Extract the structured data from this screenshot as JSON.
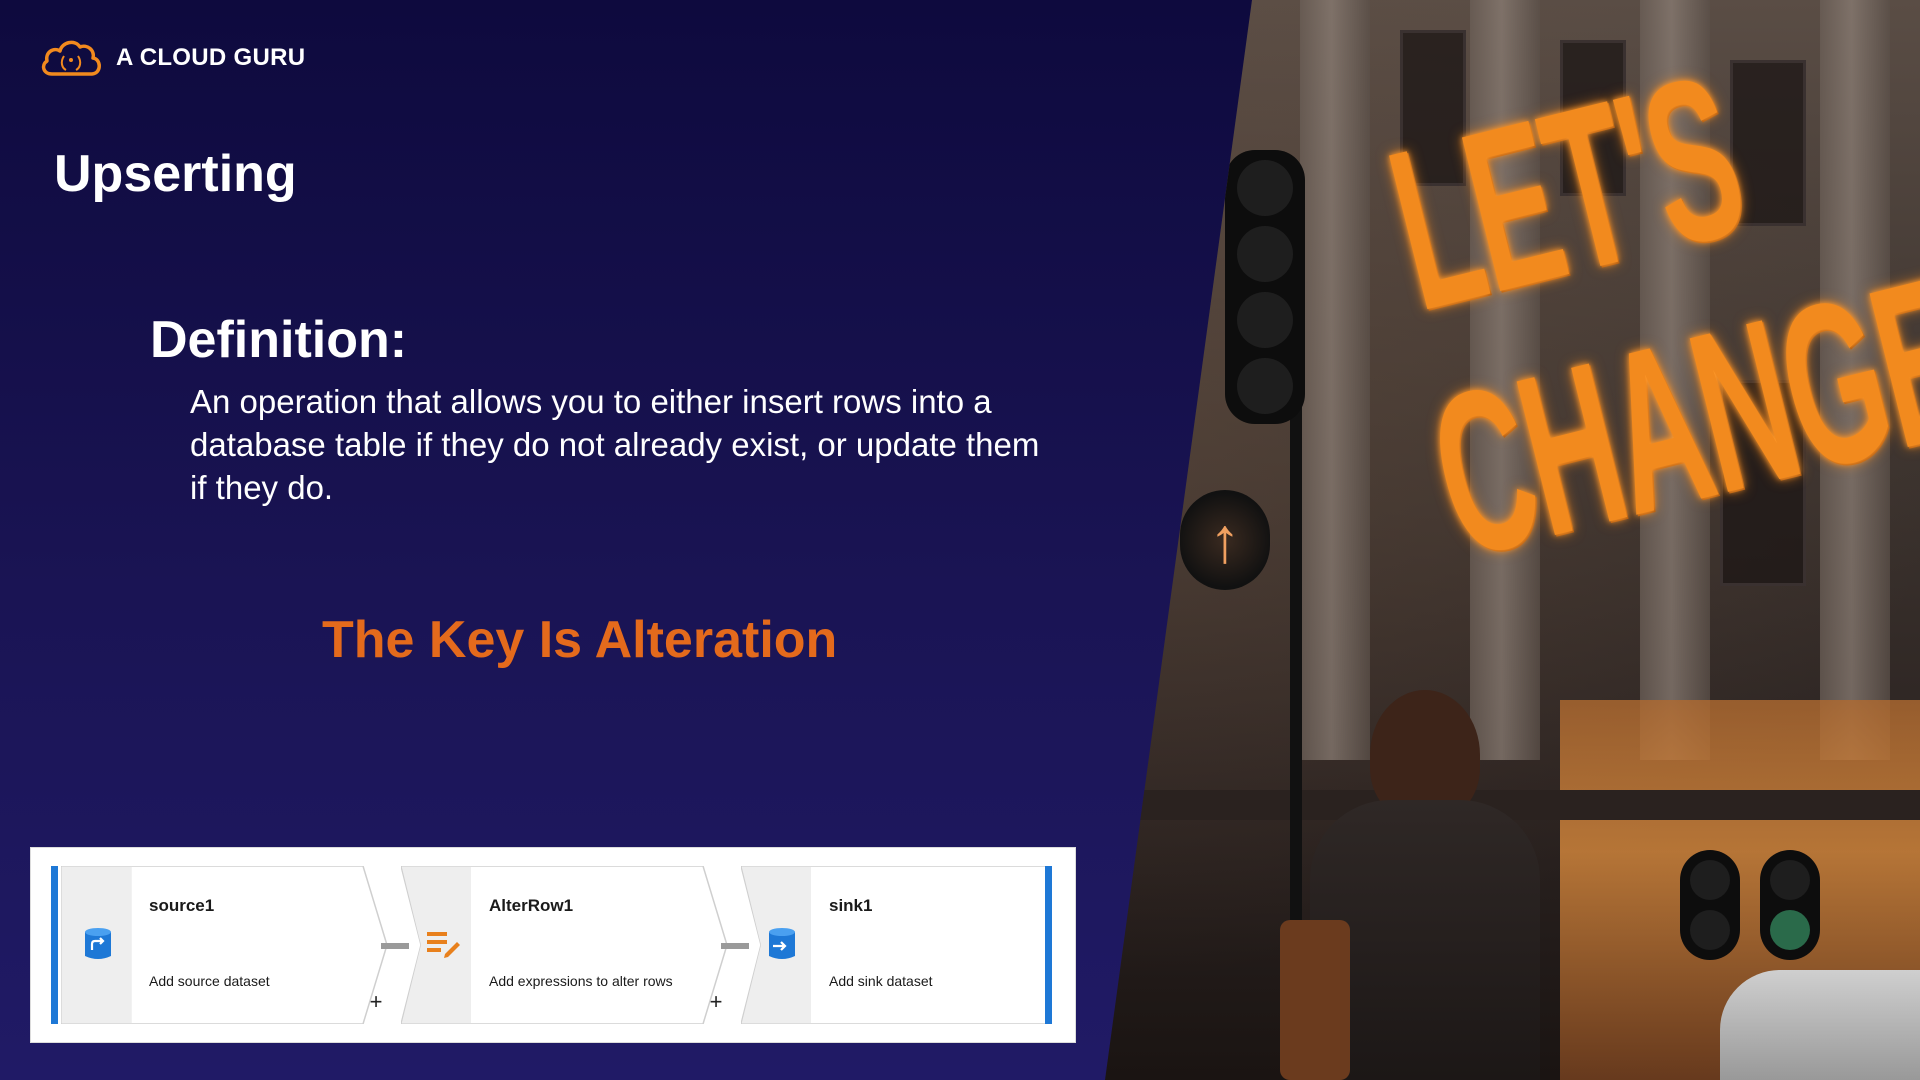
{
  "brand": {
    "name": "A CLOUD GURU",
    "logo_color": "#f28a1e"
  },
  "slide": {
    "title": "Upserting",
    "definition_heading": "Definition:",
    "definition_body": "An operation that allows you to either insert rows into a database table if they do not already exist, or update them if they do.",
    "key_line": "The Key Is Alteration",
    "accent_color": "#e46a1c",
    "background_color": "#13104a"
  },
  "photo": {
    "sign_line1": "LET'S",
    "sign_line2": "CHANGE",
    "neon_color": "#f28a1e"
  },
  "pipeline": {
    "nodes": [
      {
        "name": "source1",
        "description": "Add source dataset",
        "icon": "source-dataset-icon"
      },
      {
        "name": "AlterRow1",
        "description": "Add expressions to alter rows",
        "icon": "alter-row-icon"
      },
      {
        "name": "sink1",
        "description": "Add sink dataset",
        "icon": "sink-dataset-icon"
      }
    ],
    "add_symbol": "+",
    "edge_color": "#1e78d6"
  }
}
